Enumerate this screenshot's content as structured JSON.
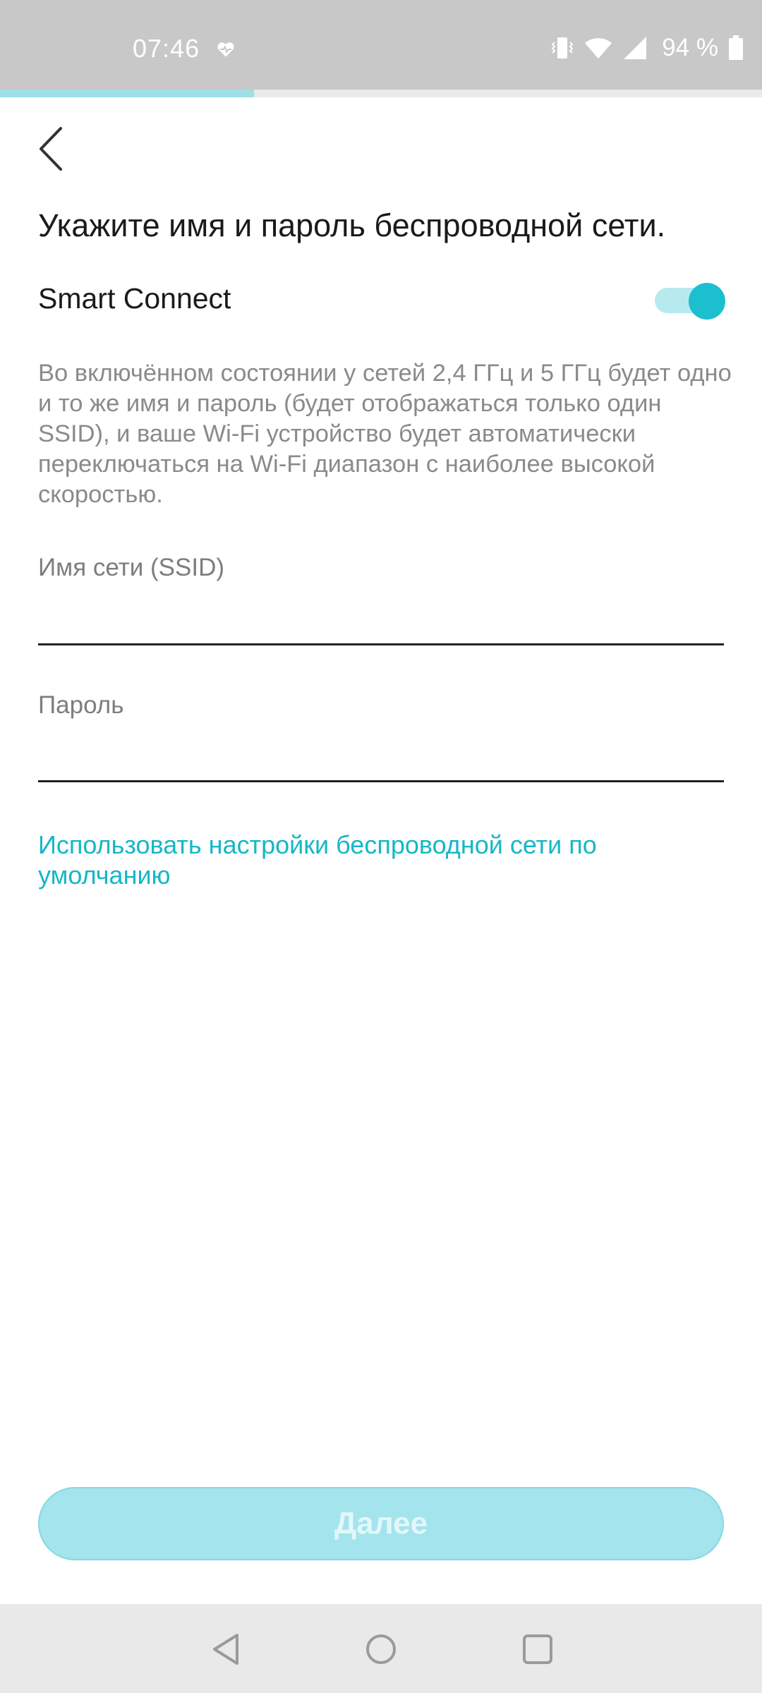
{
  "status_bar": {
    "time": "07:46",
    "battery": "94 %",
    "icons": [
      "heart-icon",
      "vibrate-icon",
      "wifi-icon",
      "signal-icon",
      "battery-icon"
    ]
  },
  "progress": {
    "fraction": 0.333
  },
  "page": {
    "title": "Укажите имя и пароль беспроводной сети.",
    "smart_connect": {
      "label": "Smart Connect",
      "enabled": true,
      "description": "Во включённом состоянии у сетей 2,4 ГГц и 5 ГГц будет одно и то же имя и пароль (будет отображаться только один SSID), и ваше Wi-Fi устройство будет автоматически переключаться на Wi-Fi диапазон с наиболее высокой скоростью."
    },
    "ssid_field": {
      "label": "Имя сети (SSID)",
      "value": ""
    },
    "password_field": {
      "label": "Пароль",
      "value": ""
    },
    "default_link": "Использовать настройки беспроводной сети по умолчанию",
    "next_button": "Далее"
  },
  "colors": {
    "accent": "#1bbfcf",
    "toggle_track": "#b7eaee",
    "link": "#16b7c6",
    "button_disabled": "#a4e4ec",
    "status_bar": "#c8c8c8"
  }
}
